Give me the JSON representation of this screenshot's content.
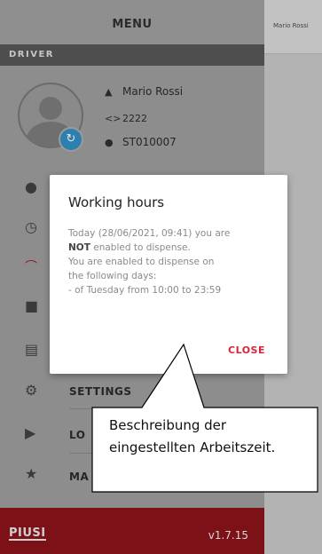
{
  "background_page": {
    "title": "Mario Rossi"
  },
  "menu": {
    "title": "MENU",
    "section_label": "DRIVER",
    "driver": {
      "name": "Mario Rossi",
      "code": "2222",
      "station": "ST010007"
    },
    "items": [
      {
        "icon": "drop-icon",
        "label": ""
      },
      {
        "icon": "clock-icon",
        "label": ""
      },
      {
        "icon": "gauge-icon",
        "label": ""
      },
      {
        "icon": "fuel-pump-icon",
        "label": ""
      },
      {
        "icon": "register-icon",
        "label": ""
      },
      {
        "icon": "gear-icon",
        "label": "SETTINGS"
      },
      {
        "icon": "logout-icon",
        "label": "LO"
      },
      {
        "icon": "star-icon",
        "label": "MA"
      }
    ],
    "footer": {
      "logo": "PIUSI",
      "version": "v1.7.15"
    }
  },
  "dialog": {
    "title": "Working hours",
    "line1": "Today (28/06/2021, 09:41) you are",
    "line2_bold": "NOT",
    "line2_rest": "enabled to dispense.",
    "line3": "You are enabled to dispense on",
    "line4": "the following days:",
    "line5": "- of Tuesday from 10:00 to 23:59",
    "close_label": "CLOSE"
  },
  "callout": {
    "line1": "Beschreibung der",
    "line2": "eingestellten Arbeitszeit."
  },
  "colors": {
    "accent": "#d7263a",
    "footer": "#7d1118",
    "sync_badge": "#2e7fb0"
  }
}
